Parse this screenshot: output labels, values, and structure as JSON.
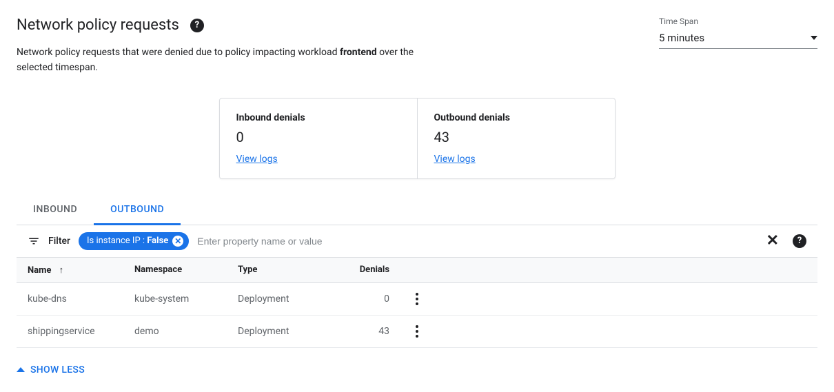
{
  "header": {
    "title": "Network policy requests",
    "description_prefix": "Network policy requests that were denied due to policy impacting workload ",
    "workload": "frontend",
    "description_suffix": " over the selected timespan."
  },
  "timespan": {
    "label": "Time Span",
    "value": "5 minutes"
  },
  "stats": {
    "inbound": {
      "label": "Inbound denials",
      "value": "0",
      "link": "View logs"
    },
    "outbound": {
      "label": "Outbound denials",
      "value": "43",
      "link": "View logs"
    }
  },
  "tabs": {
    "inbound": "INBOUND",
    "outbound": "OUTBOUND"
  },
  "filter": {
    "label": "Filter",
    "chip_key": "Is instance IP : ",
    "chip_value": "False",
    "placeholder": "Enter property name or value"
  },
  "table": {
    "headers": {
      "name": "Name",
      "namespace": "Namespace",
      "type": "Type",
      "denials": "Denials"
    },
    "rows": [
      {
        "name": "kube-dns",
        "namespace": "kube-system",
        "type": "Deployment",
        "denials": "0"
      },
      {
        "name": "shippingservice",
        "namespace": "demo",
        "type": "Deployment",
        "denials": "43"
      }
    ]
  },
  "footer": {
    "show_less": "SHOW LESS"
  }
}
